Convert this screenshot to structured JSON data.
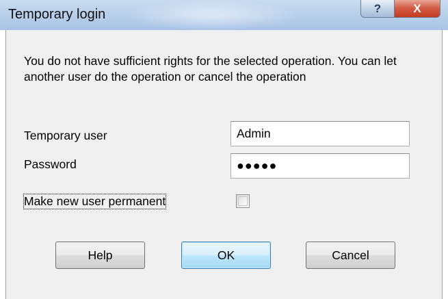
{
  "window": {
    "title": "Temporary login",
    "help_glyph": "?",
    "close_glyph": "X"
  },
  "message": "You do not have sufficient rights for the selected operation. You can let another user do the operation or cancel the operation",
  "form": {
    "user_label": "Temporary user",
    "user_value": "Admin",
    "password_label": "Password",
    "password_value": "●●●●●",
    "permanent_label": "Make new user permanent",
    "permanent_checked": false
  },
  "buttons": {
    "help": "Help",
    "ok": "OK",
    "cancel": "Cancel"
  },
  "colors": {
    "titlebar": "#b9d0ea",
    "close_button": "#c2391f",
    "dialog_bg": "#f0f0f0",
    "default_button_border": "#3c7fb1"
  }
}
